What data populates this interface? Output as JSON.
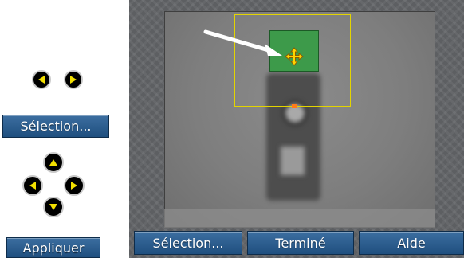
{
  "left_panel": {
    "select_button_label": "Sélection...",
    "apply_button_label": "Appliquer"
  },
  "bottom_bar": {
    "select_label": "Sélection...",
    "done_label": "Terminé",
    "help_label": "Aide"
  },
  "colors": {
    "button_blue": "#2c5f93",
    "frame_gray": "#5d5f62",
    "selection_yellow": "#e3d400",
    "target_green": "#3d9a4a",
    "marker_orange": "#ff7a1a"
  },
  "icons": {
    "left_arrow": "left-arrow-icon",
    "right_arrow": "right-arrow-icon",
    "up_arrow": "up-arrow-icon",
    "down_arrow": "down-arrow-icon",
    "move_cursor": "move-cursor-icon",
    "pointer_arrow": "pointer-arrow-icon"
  }
}
